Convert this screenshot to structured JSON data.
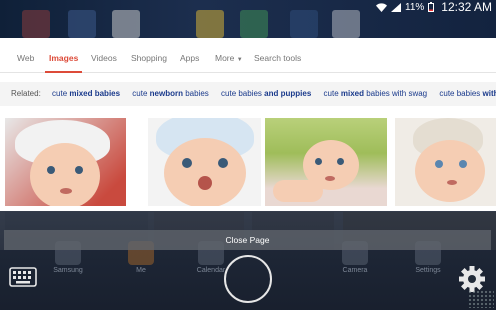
{
  "status_bar": {
    "battery": "11%",
    "time": "12:32 AM"
  },
  "search_tabs": [
    {
      "label": "Web",
      "active": false
    },
    {
      "label": "Images",
      "active": true
    },
    {
      "label": "Videos",
      "active": false
    },
    {
      "label": "Shopping",
      "active": false
    },
    {
      "label": "Apps",
      "active": false
    },
    {
      "label": "More",
      "active": false
    },
    {
      "label": "Search tools",
      "active": false
    }
  ],
  "related": {
    "label": "Related:",
    "chips": [
      {
        "plain": "cute ",
        "bold": "mixed babies",
        "tail": ""
      },
      {
        "plain": "cute ",
        "bold": "newborn",
        "tail": " babies"
      },
      {
        "plain": "cute babies ",
        "bold": "and puppies",
        "tail": ""
      },
      {
        "plain": "cute ",
        "bold": "mixed",
        "tail": " babies with swag"
      },
      {
        "plain": "cute babies ",
        "bold": "with swag",
        "tail": ""
      }
    ]
  },
  "overlay": {
    "close_page": "Close Page"
  },
  "dock_ghosts": [
    "Samsung",
    "Me",
    "Calendar",
    "Camera",
    "Settings"
  ],
  "colors": {
    "accent": "#dd4b39",
    "link": "#1a3a8c"
  },
  "icons": [
    "wifi-icon",
    "signal-icon",
    "battery-icon",
    "keyboard-icon",
    "home-button",
    "gear-icon"
  ]
}
